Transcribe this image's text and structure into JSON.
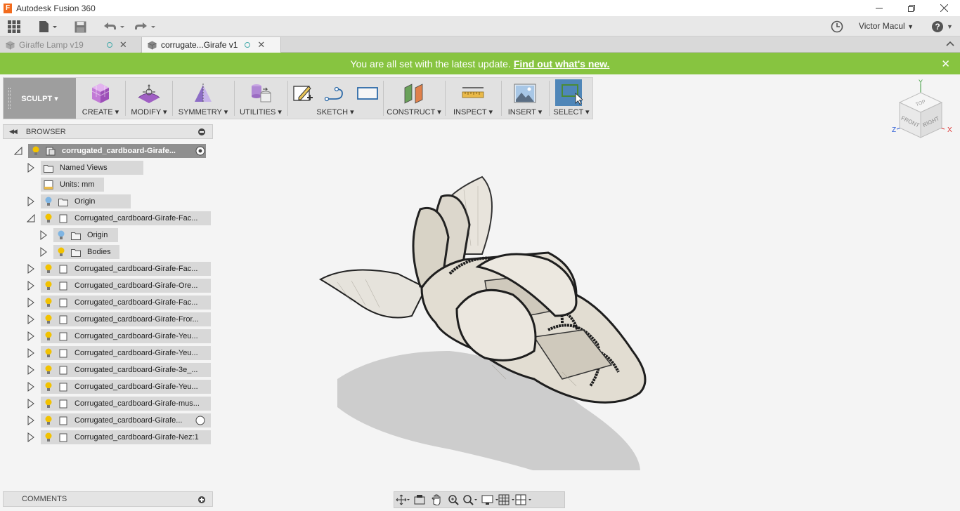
{
  "window": {
    "title": "Autodesk Fusion 360",
    "logo_letter": "F"
  },
  "toolbar": {
    "user_name": "Victor Macul",
    "user_dropdown": "▼",
    "help_dropdown": "▼"
  },
  "tabs": [
    {
      "label": "Giraffe Lamp v19",
      "active": false
    },
    {
      "label": "corrugate...Girafe v1",
      "active": true
    }
  ],
  "notice": {
    "text": "You are all set with the latest update.",
    "link": "Find out what's new.",
    "close": "✕"
  },
  "ribbon": {
    "workspace": "SCULPT ▾",
    "groups": [
      {
        "label": "CREATE ▾"
      },
      {
        "label": "MODIFY ▾"
      },
      {
        "label": "SYMMETRY ▾"
      },
      {
        "label": "UTILITIES ▾"
      },
      {
        "label": "SKETCH ▾"
      },
      {
        "label": "CONSTRUCT ▾"
      },
      {
        "label": "INSPECT ▾"
      },
      {
        "label": "INSERT ▾"
      },
      {
        "label": "SELECT ▾"
      }
    ]
  },
  "viewcube": {
    "top": "TOP",
    "front": "FRONT",
    "right": "RIGHT",
    "axis_x": "X",
    "axis_y": "Y",
    "axis_z": "Z"
  },
  "browser": {
    "title": "BROWSER",
    "root": "corrugated_cardboard-Girafe...",
    "items": [
      {
        "label": "Named Views"
      },
      {
        "label": "Units: mm"
      },
      {
        "label": "Origin"
      },
      {
        "label": "Corrugated_cardboard-Girafe-Fac..."
      },
      {
        "label": "Origin"
      },
      {
        "label": "Bodies"
      },
      {
        "label": "Corrugated_cardboard-Girafe-Fac..."
      },
      {
        "label": "Corrugated_cardboard-Girafe-Ore..."
      },
      {
        "label": "Corrugated_cardboard-Girafe-Fac..."
      },
      {
        "label": "Corrugated_cardboard-Girafe-Fror..."
      },
      {
        "label": "Corrugated_cardboard-Girafe-Yeu..."
      },
      {
        "label": "Corrugated_cardboard-Girafe-Yeu..."
      },
      {
        "label": "Corrugated_cardboard-Girafe-3e_..."
      },
      {
        "label": "Corrugated_cardboard-Girafe-Yeu..."
      },
      {
        "label": "Corrugated_cardboard-Girafe-mus..."
      },
      {
        "label": "Corrugated_cardboard-Girafe..."
      },
      {
        "label": "Corrugated_cardboard-Girafe-Nez:1"
      }
    ]
  },
  "comments": {
    "title": "COMMENTS"
  },
  "colors": {
    "notice_bg": "#87c440",
    "select_active": "#4f86b8",
    "workspace_bg": "#9e9e9e"
  }
}
